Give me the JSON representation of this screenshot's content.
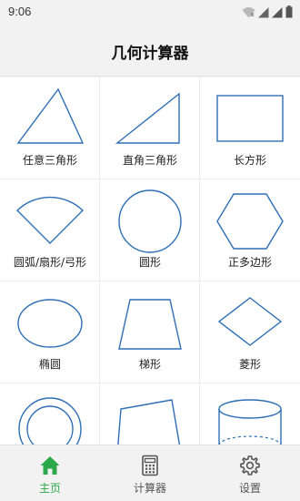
{
  "status_bar": {
    "time": "9:06"
  },
  "app_bar": {
    "title": "几何计算器"
  },
  "shapes": [
    {
      "label": "任意三角形",
      "icon": "triangle-icon"
    },
    {
      "label": "直角三角形",
      "icon": "right-triangle-icon"
    },
    {
      "label": "长方形",
      "icon": "rectangle-icon"
    },
    {
      "label": "圆弧/扇形/弓形",
      "icon": "sector-icon"
    },
    {
      "label": "圆形",
      "icon": "circle-icon"
    },
    {
      "label": "正多边形",
      "icon": "hexagon-icon"
    },
    {
      "label": "椭圆",
      "icon": "ellipse-icon"
    },
    {
      "label": "梯形",
      "icon": "trapezoid-icon"
    },
    {
      "label": "菱形",
      "icon": "rhombus-icon"
    },
    {
      "label": "",
      "icon": "ring-icon"
    },
    {
      "label": "",
      "icon": "quadrilateral-icon"
    },
    {
      "label": "",
      "icon": "cylinder-icon"
    }
  ],
  "bottom_nav": {
    "items": [
      {
        "label": "主页",
        "icon": "home-icon",
        "active": true
      },
      {
        "label": "计算器",
        "icon": "calculator-icon",
        "active": false
      },
      {
        "label": "设置",
        "icon": "gear-icon",
        "active": false
      }
    ]
  },
  "colors": {
    "shape_stroke": "#2f6fb5",
    "accent": "#2aa84a",
    "background": "#f2f2f2"
  }
}
